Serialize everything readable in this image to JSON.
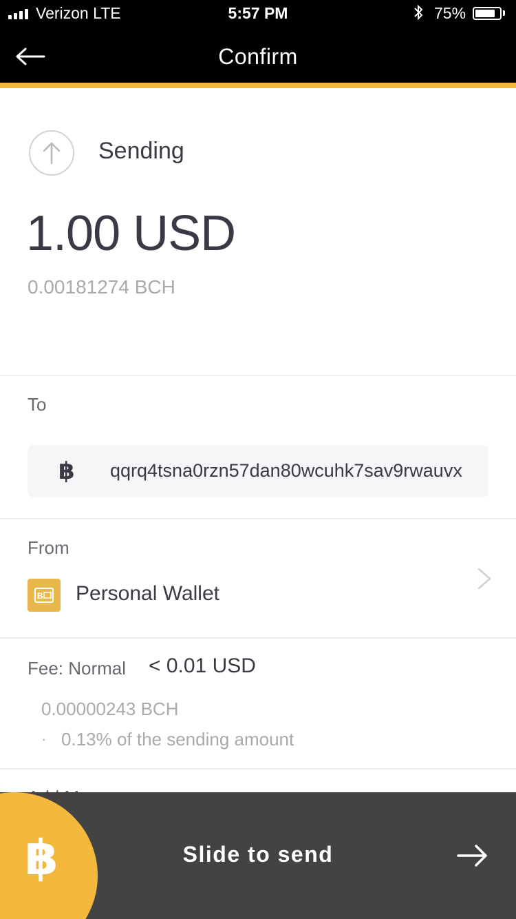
{
  "status_bar": {
    "carrier": "Verizon  LTE",
    "time": "5:57 PM",
    "battery_percent": "75%",
    "battery_level": 0.75,
    "bluetooth_icon": "bluetooth-icon"
  },
  "nav": {
    "back_icon": "back-arrow-icon",
    "title": "Confirm"
  },
  "sending": {
    "label": "Sending",
    "icon": "arrow-up-circle-icon",
    "amount": "1.00 USD",
    "crypto_amount": "0.00181274 BCH"
  },
  "to": {
    "label": "To",
    "currency_icon": "bitcoin-icon",
    "address": "qqrq4tsna0rzn57dan80wcuhk7sav9rwauvx"
  },
  "from": {
    "label": "From",
    "wallet_icon": "wallet-icon",
    "wallet_name": "Personal Wallet",
    "chevron_icon": "chevron-right-icon"
  },
  "fee": {
    "label": "Fee: Normal",
    "amount": "< 0.01 USD",
    "crypto_amount": "0.00000243 BCH",
    "bullet": "·",
    "percent_text": "0.13% of the sending amount"
  },
  "partially_hidden_label": "Add M",
  "slider": {
    "knob_icon": "bitcoin-icon",
    "label": "Slide to send",
    "arrow_icon": "arrow-right-icon"
  },
  "colors": {
    "accent": "#f4b93c",
    "nav_bg": "#000000",
    "slider_bg": "#434343",
    "wallet_icon_bg": "#e9b84d"
  }
}
